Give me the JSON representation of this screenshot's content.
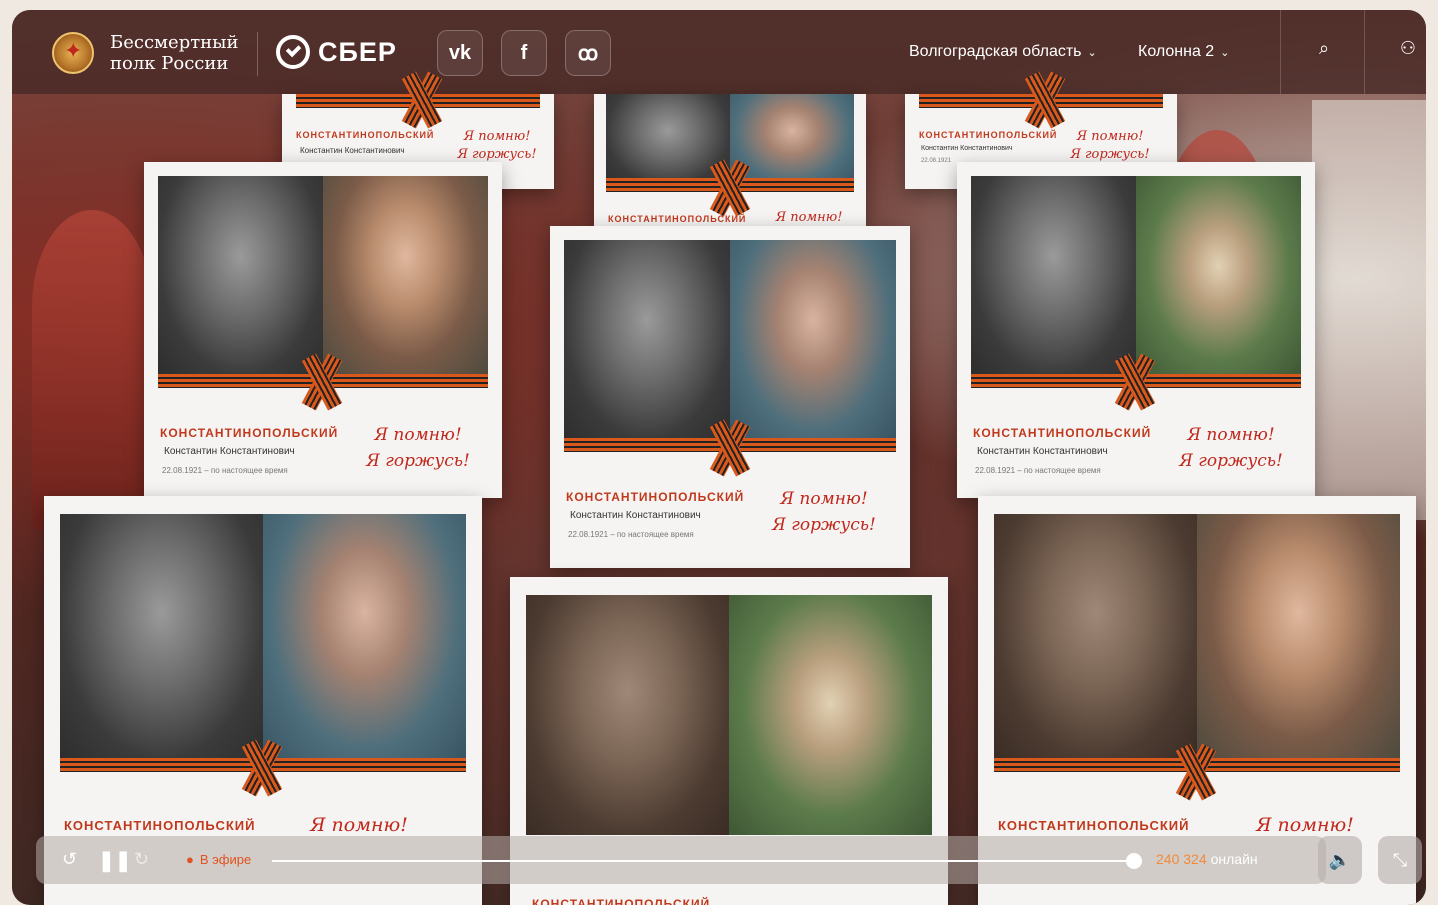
{
  "header": {
    "logo_line1": "Бессмертный",
    "logo_line2": "полк России",
    "sber_label": "СБЕР",
    "social": {
      "vk": "vk",
      "facebook": "f",
      "ok": "ok"
    },
    "region": "Волгоградская область",
    "column": "Колонна 2",
    "icons": {
      "search": "search-icon",
      "profile": "user-icon",
      "chevron": "chevron-down-icon"
    }
  },
  "cards": [
    {
      "surname": "КОНСТАНТИНОПОЛЬСКИЙ",
      "name": "Константин Константинович",
      "dates": "",
      "slogan1": "Я помню!",
      "slogan2": "Я горжусь!"
    },
    {
      "surname": "КОНСТАНТИНОПОЛЬСКИЙ",
      "name": "",
      "dates": "",
      "slogan1": "Я помню!",
      "slogan2": ""
    },
    {
      "surname": "КОНСТАНТИНОПОЛЬСКИЙ",
      "name": "Константин Константинович",
      "dates": "22.08.1921",
      "slogan1": "Я помню!",
      "slogan2": "Я горжусь!"
    },
    {
      "surname": "КОНСТАНТИНОПОЛЬСКИЙ",
      "name": "Константин Константинович",
      "dates": "22.08.1921 – по настоящее время",
      "slogan1": "Я помню!",
      "slogan2": "Я горжусь!"
    },
    {
      "surname": "КОНСТАНТИНОПОЛЬСКИЙ",
      "name": "Константин Константинович",
      "dates": "22.08.1921 – по настоящее время",
      "slogan1": "Я помню!",
      "slogan2": "Я горжусь!"
    },
    {
      "surname": "КОНСТАНТИНОПОЛЬСКИЙ",
      "name": "Константин Константинович",
      "dates": "22.08.1921 – по настоящее время",
      "slogan1": "Я помню!",
      "slogan2": "Я горжусь!"
    },
    {
      "surname": "КОНСТАНТИНОПОЛЬСКИЙ",
      "name": "",
      "dates": "",
      "slogan1": "Я помню!",
      "slogan2": ""
    },
    {
      "surname": "КОНСТАНТИНОПОЛЬСКИЙ",
      "name": "",
      "dates": "",
      "slogan1": "",
      "slogan2": ""
    },
    {
      "surname": "КОНСТАНТИНОПОЛЬСКИЙ",
      "name": "",
      "dates": "",
      "slogan1": "Я помню!",
      "slogan2": ""
    }
  ],
  "player": {
    "live_label": "В эфире",
    "viewers_count": "240 324",
    "viewers_label": "онлайн",
    "progress": 0.99,
    "icons": {
      "rewind": "replay-10-icon",
      "pause": "pause-icon",
      "forward": "forward-10-icon",
      "mute": "mute-icon",
      "collapse": "collapse-icon"
    }
  },
  "colors": {
    "accent": "#c0391d",
    "ribbon_orange": "#d9581c",
    "live": "#e0521f"
  }
}
